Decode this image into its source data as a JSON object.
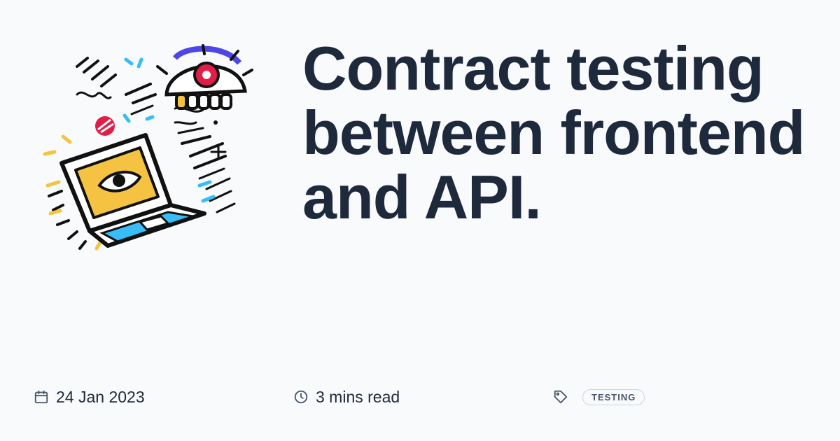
{
  "post": {
    "title": "Contract testing between frontend and API."
  },
  "meta": {
    "date": "24 Jan 2023",
    "read_time": "3 mins read",
    "tags": [
      "TESTING"
    ]
  },
  "icons": {
    "date": "calendar-icon",
    "read_time": "clock-icon",
    "tags": "tag-icon"
  },
  "colors": {
    "background": "#f8fafc",
    "text": "#1e293b",
    "accent_yellow": "#f5c242",
    "accent_blue": "#38bdf8",
    "accent_red": "#e11d48",
    "accent_indigo": "#4f46e5"
  }
}
